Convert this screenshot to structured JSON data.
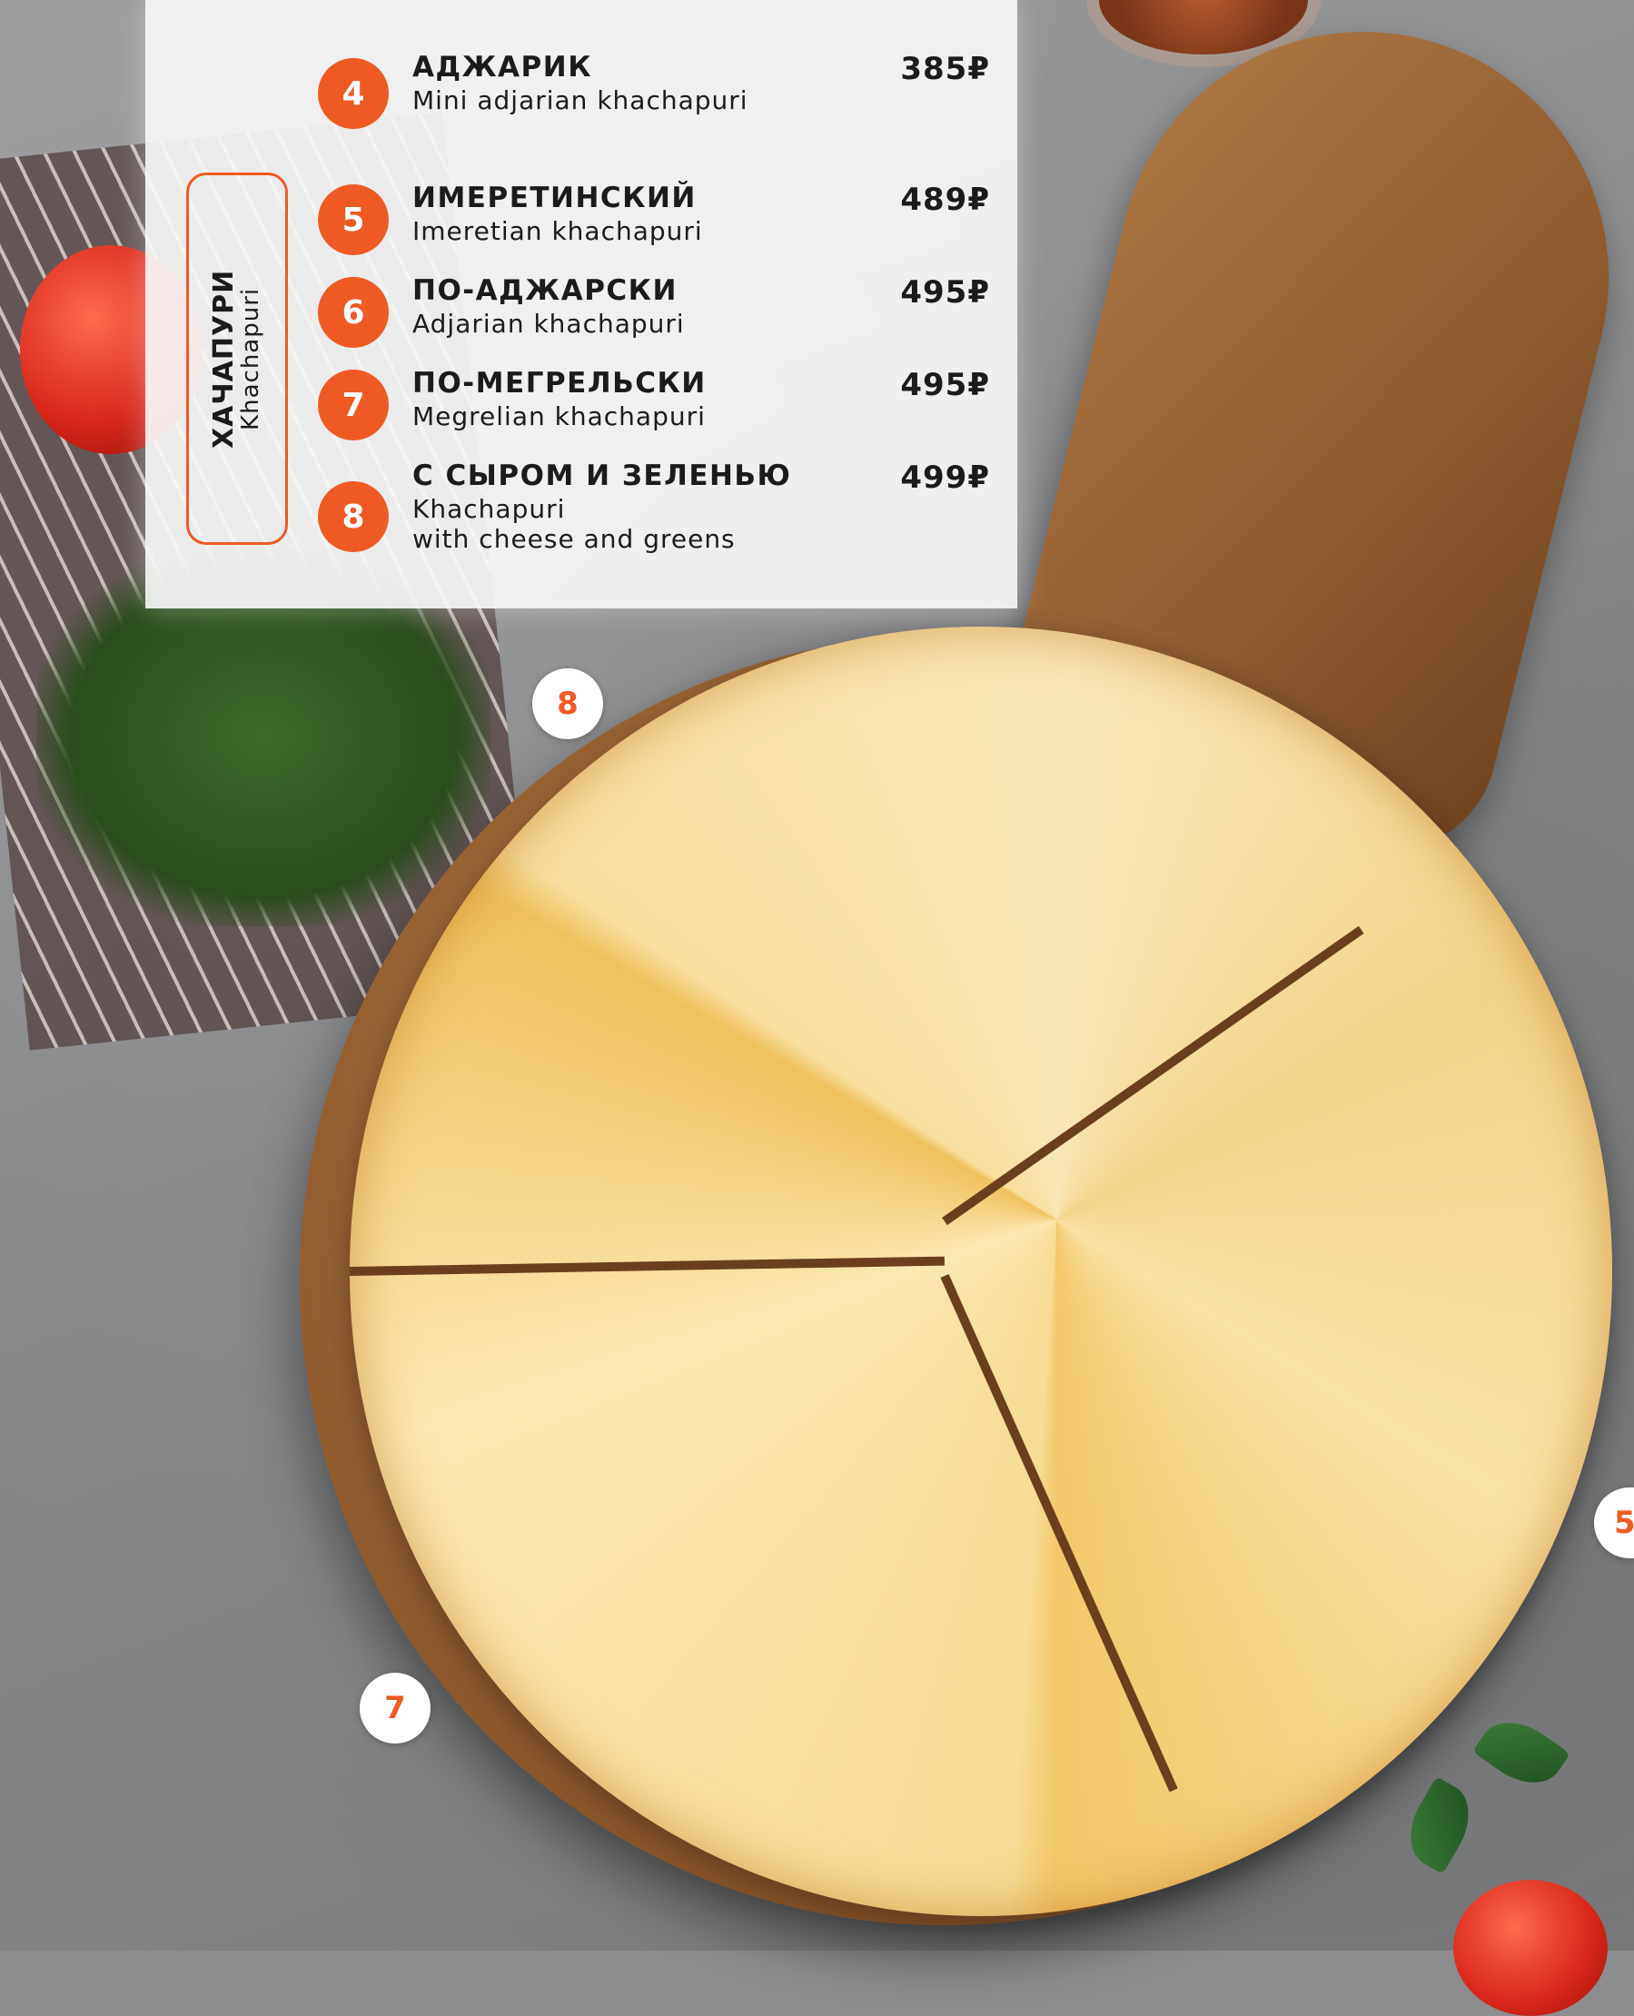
{
  "section": {
    "title_ru": "ХАЧАПУРИ",
    "title_en": "Khachapuri"
  },
  "items": [
    {
      "num": "4",
      "name": "АДЖАРИК",
      "sub": "Mini adjarian khachapuri",
      "price": "385₽"
    },
    {
      "num": "5",
      "name": "ИМЕРЕТИНСКИЙ",
      "sub": "Imeretian khachapuri",
      "price": "489₽"
    },
    {
      "num": "6",
      "name": "ПО-АДЖАРСКИ",
      "sub": "Adjarian khachapuri",
      "price": "495₽"
    },
    {
      "num": "7",
      "name": "ПО-МЕГРЕЛЬСКИ",
      "sub": "Megrelian khachapuri",
      "price": "495₽"
    },
    {
      "num": "8",
      "name": "С СЫРОМ И ЗЕЛЕНЬЮ",
      "sub_line1": "Khachapuri",
      "sub_line2": "with cheese and greens",
      "price": "499₽"
    }
  ],
  "markers": {
    "m8": "8",
    "m7": "7",
    "m5": "5"
  },
  "colors": {
    "accent": "#ef5a24",
    "text": "#1b1b1b"
  }
}
